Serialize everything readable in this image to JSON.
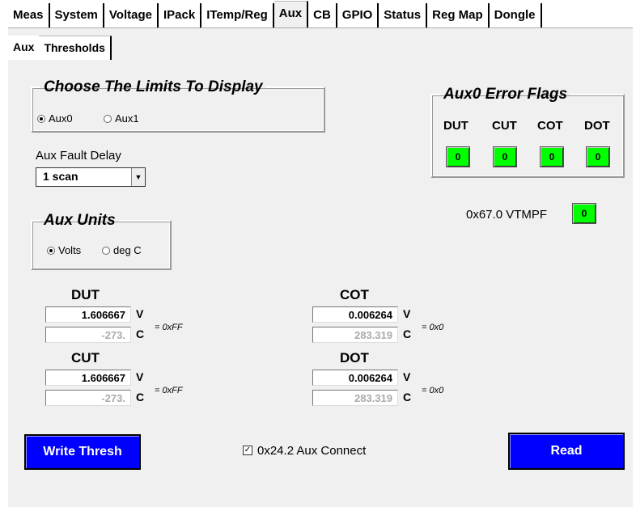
{
  "tabs": [
    "Meas",
    "System",
    "Voltage",
    "IPack",
    "ITemp/Reg",
    "Aux",
    "CB",
    "GPIO",
    "Status",
    "Reg Map",
    "Dongle"
  ],
  "subtabs": [
    "Aux",
    "Thresholds"
  ],
  "limits": {
    "title": "Choose The  Limits To Display",
    "options": [
      "Aux0",
      "Aux1"
    ],
    "selected": "Aux0"
  },
  "fault_delay": {
    "label": "Aux Fault Delay",
    "value": "1 scan"
  },
  "units": {
    "title": "Aux Units",
    "options": [
      "Volts",
      "deg C"
    ],
    "selected": "Volts"
  },
  "error_flags": {
    "title": "Aux0 Error Flags",
    "flags": [
      {
        "label": "DUT",
        "value": "0"
      },
      {
        "label": "CUT",
        "value": "0"
      },
      {
        "label": "COT",
        "value": "0"
      },
      {
        "label": "DOT",
        "value": "0"
      }
    ],
    "vtmpf_label": "0x67.0 VTMPF",
    "vtmpf_value": "0",
    "led_color": "#00ff00"
  },
  "thresholds": {
    "dut": {
      "title": "DUT",
      "volts": "1.606667",
      "celsius": "-273.",
      "v_unit": "V",
      "c_unit": "C",
      "eq": "= 0xFF"
    },
    "cut": {
      "title": "CUT",
      "volts": "1.606667",
      "celsius": "-273.",
      "v_unit": "V",
      "c_unit": "C",
      "eq": "= 0xFF"
    },
    "cot": {
      "title": "COT",
      "volts": "0.006264",
      "celsius": "283.319",
      "v_unit": "V",
      "c_unit": "C",
      "eq": "= 0x0"
    },
    "dot": {
      "title": "DOT",
      "volts": "0.006264",
      "celsius": "283.319",
      "v_unit": "V",
      "c_unit": "C",
      "eq": "= 0x0"
    }
  },
  "buttons": {
    "write": "Write Thresh",
    "read": "Read",
    "color": "#0000ff"
  },
  "aux_connect": {
    "label": "0x24.2 Aux Connect",
    "checked": true,
    "mark": "✓"
  }
}
